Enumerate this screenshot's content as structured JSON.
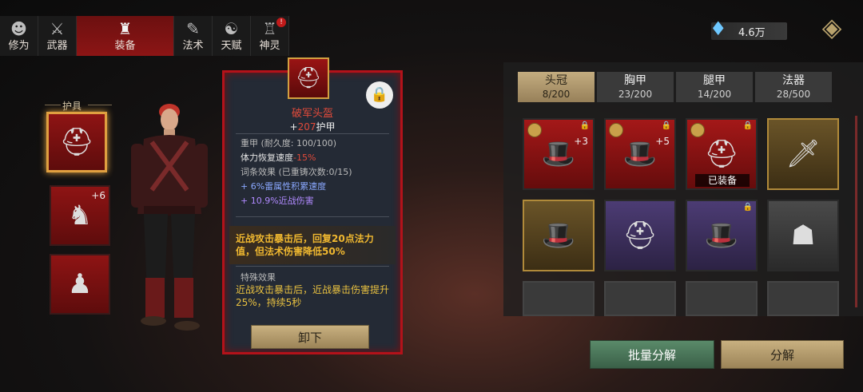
{
  "nav": {
    "tabs": [
      {
        "label": "修为",
        "icon": "person-head-icon"
      },
      {
        "label": "武器",
        "icon": "weapon-icon"
      },
      {
        "label": "装备",
        "icon": "robe-icon"
      },
      {
        "label": "法术",
        "icon": "scroll-icon"
      },
      {
        "label": "天赋",
        "icon": "yin-yang-icon"
      },
      {
        "label": "神灵",
        "icon": "shrine-icon",
        "badge": "!"
      }
    ],
    "active_index": 2
  },
  "currency": {
    "value": "4.6万",
    "icon": "crystal-gem-icon"
  },
  "equip_slots": {
    "header": "护具",
    "slots": [
      {
        "type": "helmet",
        "icon": "plumed-helmet-icon",
        "selected": true
      },
      {
        "type": "chest",
        "icon": "armor-icon",
        "plus": "+6"
      },
      {
        "type": "legs",
        "icon": "boots-icon"
      }
    ]
  },
  "detail": {
    "name": "破军头盔",
    "armor_prefix": "+",
    "armor_value": "207",
    "armor_suffix": "护甲",
    "weight_line": "重甲  (耐久度: 100/100)",
    "stamina_label": "体力恢复速度",
    "stamina_value": "-15%",
    "affix_header": "词条效果  (已重铸次数:0/15)",
    "affixes": [
      "+ 6%雷属性积累速度",
      "+ 10.9%近战伤害"
    ],
    "effect": "近战攻击暴击后，回复20点法力值，但法术伤害降低50%",
    "special_title": "特殊效果",
    "special_text": "近战攻击暴击后，近战暴击伤害提升25%，持续5秒",
    "unequip_label": "卸下"
  },
  "inventory": {
    "tabs": [
      {
        "label": "头冠",
        "count": "8/200"
      },
      {
        "label": "胸甲",
        "count": "23/200"
      },
      {
        "label": "腿甲",
        "count": "14/200"
      },
      {
        "label": "法器",
        "count": "28/500"
      }
    ],
    "active_tab": 0,
    "equipped_label": "已装备",
    "items": [
      {
        "rarity": "red",
        "icon": "black-hat-icon",
        "coin": true,
        "locked": true,
        "plus": "+3"
      },
      {
        "rarity": "red",
        "icon": "black-hat-icon",
        "coin": true,
        "locked": true,
        "plus": "+5"
      },
      {
        "rarity": "red",
        "icon": "plumed-helmet-icon",
        "coin": true,
        "locked": true,
        "equipped": true
      },
      {
        "rarity": "gold",
        "icon": "dagger-icon"
      },
      {
        "rarity": "gold",
        "icon": "black-hat-icon"
      },
      {
        "rarity": "purple",
        "icon": "war-helmet-icon"
      },
      {
        "rarity": "purple",
        "icon": "black-hat-icon",
        "locked": true
      },
      {
        "rarity": "gray",
        "icon": "hood-icon"
      },
      {
        "rarity": "empty"
      },
      {
        "rarity": "empty"
      },
      {
        "rarity": "empty"
      },
      {
        "rarity": "empty"
      }
    ]
  },
  "actions": {
    "batch_label": "批量分解",
    "decompose_label": "分解"
  },
  "colors": {
    "accent_red": "#b3121a",
    "gold": "#c4ad80",
    "green_button": "#4a7458"
  }
}
